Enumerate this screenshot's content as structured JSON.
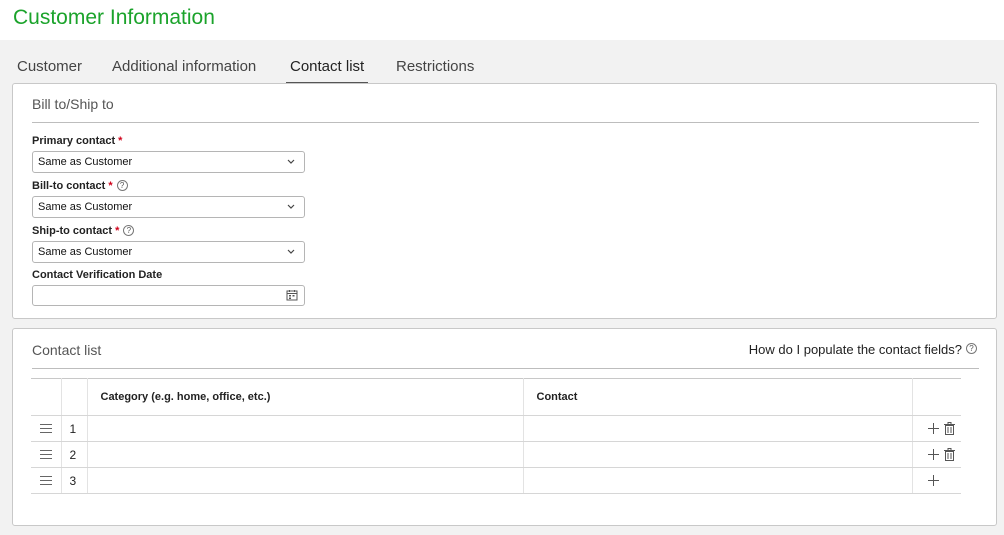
{
  "page": {
    "title": "Customer Information"
  },
  "tabs": [
    {
      "label": "Customer"
    },
    {
      "label": "Additional information"
    },
    {
      "label": "Contact list",
      "active": true
    },
    {
      "label": "Restrictions"
    }
  ],
  "bill_ship": {
    "title": "Bill to/Ship to",
    "primary_contact": {
      "label": "Primary contact",
      "required_mark": "*",
      "value": "Same as Customer"
    },
    "bill_to_contact": {
      "label": "Bill-to contact",
      "required_mark": "*",
      "help": "?",
      "value": "Same as Customer"
    },
    "ship_to_contact": {
      "label": "Ship-to contact",
      "required_mark": "*",
      "help": "?",
      "value": "Same as Customer"
    },
    "verification_date": {
      "label": "Contact Verification Date",
      "value": ""
    }
  },
  "contact_list": {
    "title": "Contact list",
    "help_link": "How do I populate the contact fields?",
    "help_icon": "?",
    "columns": {
      "category": "Category (e.g. home, office, etc.)",
      "contact": "Contact"
    },
    "rows": [
      {
        "num": "1",
        "category": "",
        "contact": ""
      },
      {
        "num": "2",
        "category": "",
        "contact": ""
      },
      {
        "num": "3",
        "category": "",
        "contact": ""
      }
    ]
  },
  "colors": {
    "brand_green": "#1ba32b",
    "required_red": "#d0021b"
  }
}
